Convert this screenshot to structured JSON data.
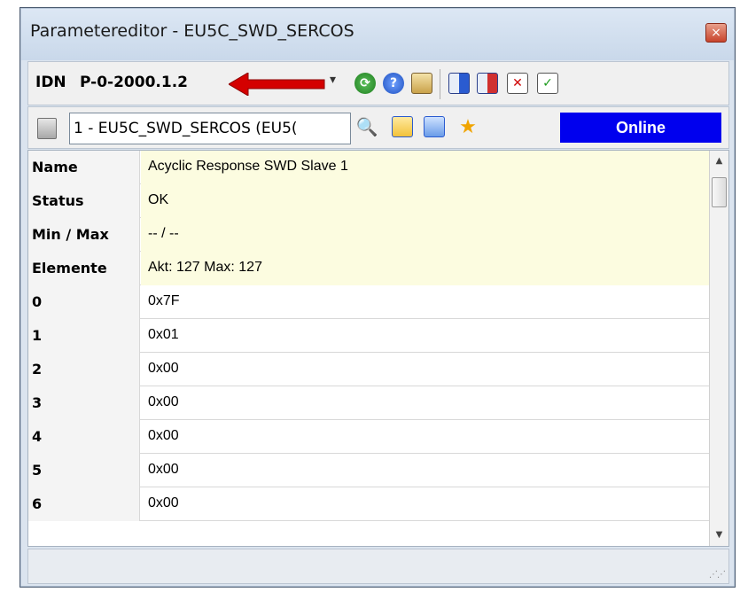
{
  "window": {
    "title": "Parametereditor - EU5C_SWD_SERCOS",
    "close_glyph": "×"
  },
  "toolbar": {
    "idn_label": "IDN",
    "idn_value": "P-0-2000.1.2",
    "icons": [
      "refresh-icon",
      "help-icon",
      "clipboard-icon",
      "import-icon",
      "export-icon",
      "delete-icon",
      "check-icon"
    ]
  },
  "device_bar": {
    "device_value": "1 - EU5C_SWD_SERCOS (EU5(",
    "status": "Online",
    "status_color": "#0000ee",
    "icons": [
      "device-icon",
      "binoculars-icon",
      "table-icon",
      "table-import-icon",
      "star-icon"
    ]
  },
  "grid": {
    "meta_rows": [
      {
        "label": "Name",
        "value": "Acyclic Response SWD Slave 1"
      },
      {
        "label": "Status",
        "value": "OK"
      },
      {
        "label": "Min / Max",
        "value": "-- / --"
      },
      {
        "label": "Elemente",
        "value": "Akt: 127  Max: 127"
      }
    ],
    "element_rows": [
      {
        "label": "0",
        "value": "0x7F"
      },
      {
        "label": "1",
        "value": "0x01"
      },
      {
        "label": "2",
        "value": "0x00"
      },
      {
        "label": "3",
        "value": "0x00"
      },
      {
        "label": "4",
        "value": "0x00"
      },
      {
        "label": "5",
        "value": "0x00"
      },
      {
        "label": "6",
        "value": "0x00"
      }
    ],
    "meta_row_color": "#fcfce0"
  }
}
